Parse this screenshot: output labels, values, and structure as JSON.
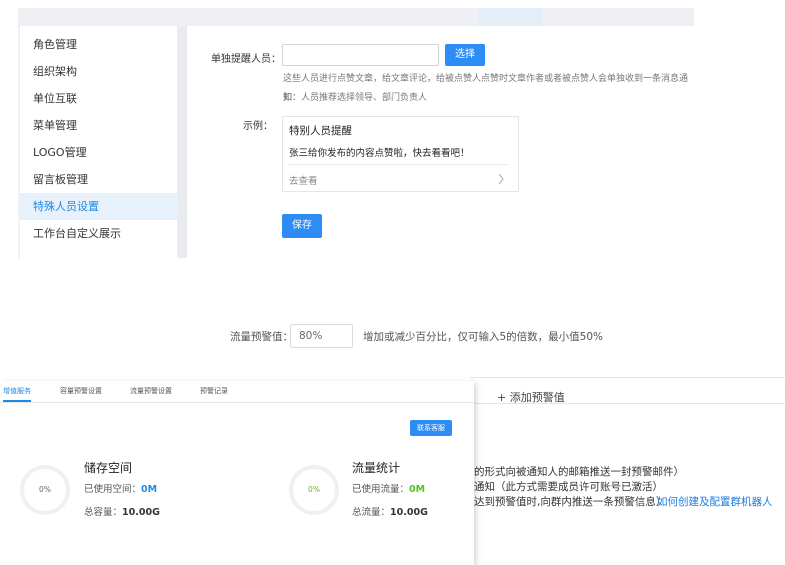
{
  "sidebar": {
    "items": [
      {
        "label": "角色管理",
        "active": false
      },
      {
        "label": "组织架构",
        "active": false
      },
      {
        "label": "单位互联",
        "active": false
      },
      {
        "label": "菜单管理",
        "active": false
      },
      {
        "label": "LOGO管理",
        "active": false
      },
      {
        "label": "留言板管理",
        "active": false
      },
      {
        "label": "特殊人员设置",
        "active": true
      },
      {
        "label": "工作台自定义展示",
        "active": false
      }
    ]
  },
  "reminder_form": {
    "person_label": "单独提醒人员：",
    "person_value": "",
    "select_button": "选择",
    "description_line1": "这些人员进行点赞文章，给文章评论，给被点赞人点赞时文章作者或者被点赞人会单独收到一条消息通知",
    "description_line2": "如：人员推荐选择领导、部门负责人",
    "example_label": "示例：",
    "example_card": {
      "title": "特别人员提醒",
      "body": "张三给你发布的内容点赞啦，快去看看吧！",
      "link": "去查看",
      "chevron_icon": "chevron-right-icon"
    },
    "save_button": "保存"
  },
  "traffic_alert": {
    "label": "流量预警值：",
    "value": "80%",
    "hint": "增加或减少百分比，仅可输入5的倍数，最小值50%"
  },
  "alert_panel": {
    "add_button": "+ 添加预警值",
    "line1": "的形式向被通知人的邮箱推送一封预警邮件）",
    "line2": "通知（此方式需要成员许可账号已激活）",
    "line3": "达到预警值时,向群内推送一条预警信息）",
    "help_link": "如何创建及配置群机器人"
  },
  "storage_window": {
    "tabs": [
      {
        "label": "增值服务",
        "active": true
      },
      {
        "label": "容量预警设置",
        "active": false
      },
      {
        "label": "流量预警设置",
        "active": false
      },
      {
        "label": "预警记录",
        "active": false
      }
    ],
    "contact_button": "联系客服",
    "storage": {
      "title": "储存空间",
      "used_label": "已使用空间：",
      "used_value": "0M",
      "total_label": "总容量：",
      "total_value": "10.00G",
      "percent": "0%",
      "color": "#1e8ae6"
    },
    "traffic": {
      "title": "流量统计",
      "used_label": "已使用流量：",
      "used_value": "0M",
      "total_label": "总流量：",
      "total_value": "10.00G",
      "percent": "0%",
      "color": "#52c41a"
    }
  },
  "colors": {
    "accent": "#2d8df5",
    "sidebar_active_bg": "#e6f1fc",
    "green": "#52c41a"
  }
}
